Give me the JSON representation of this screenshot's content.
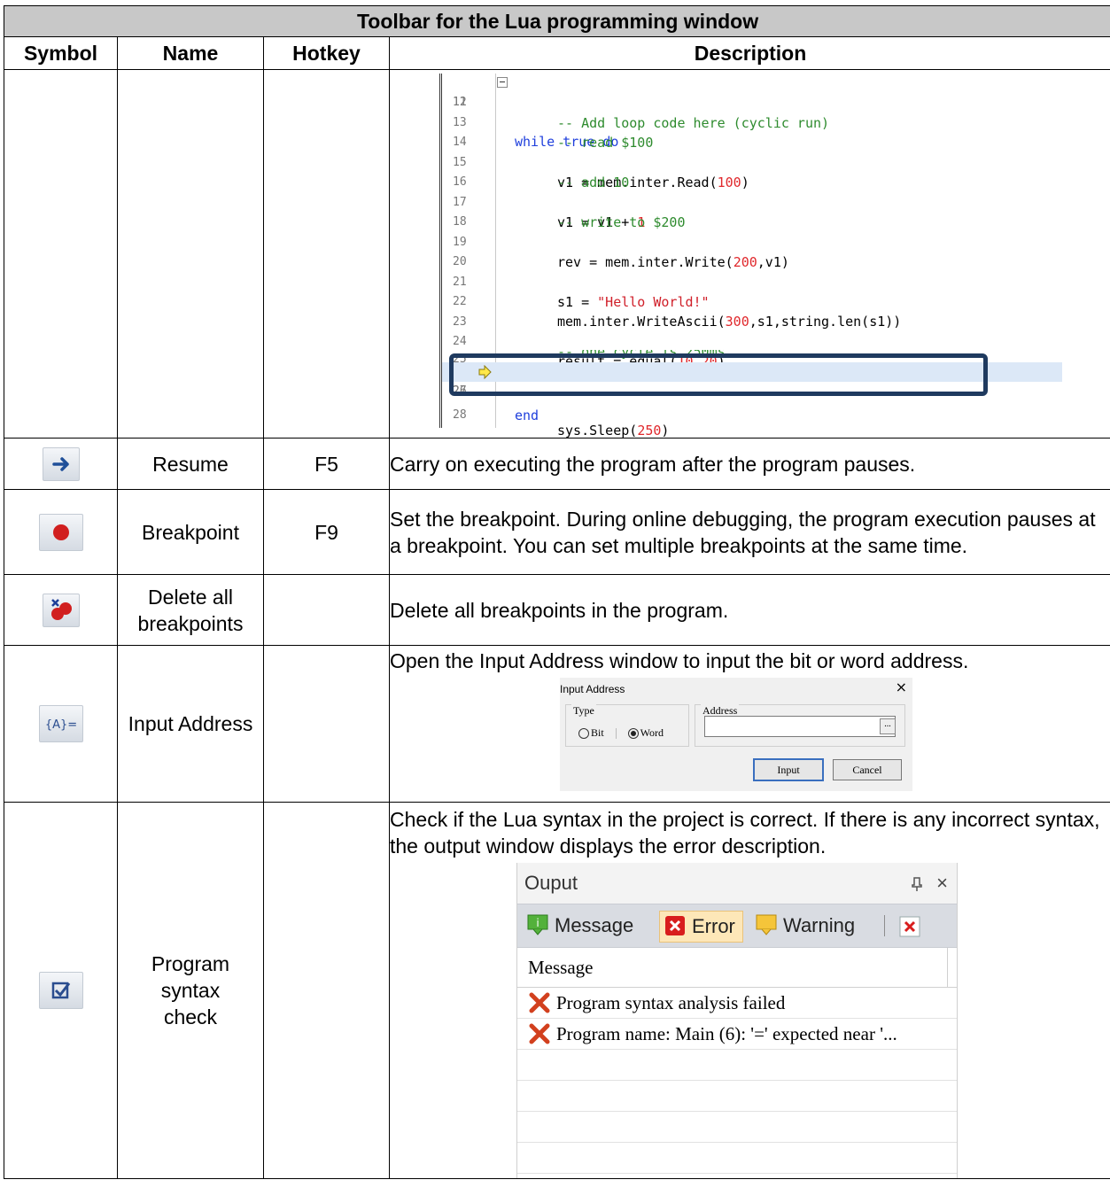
{
  "table": {
    "title": "Toolbar for the Lua programming window",
    "headers": {
      "symbol": "Symbol",
      "name": "Name",
      "hotkey": "Hotkey",
      "description": "Description"
    }
  },
  "code": {
    "lines": [
      {
        "num": "11",
        "text": "while true do"
      },
      {
        "num": "12",
        "text": ""
      },
      {
        "num": "13",
        "text": "-- Add loop code here (cyclic run)"
      },
      {
        "num": "14",
        "text": "-- read $100"
      },
      {
        "num": "15",
        "text": "v1 = mem.inter.Read(100)"
      },
      {
        "num": "16",
        "text": "-- add 10"
      },
      {
        "num": "17",
        "text": "v1 = v1 + 1"
      },
      {
        "num": "18",
        "text": "-- write to $200"
      },
      {
        "num": "19",
        "text": "rev = mem.inter.Write(200,v1)"
      },
      {
        "num": "20",
        "text": ""
      },
      {
        "num": "21",
        "text": "s1 = \"Hello World!\""
      },
      {
        "num": "22",
        "text": "mem.inter.WriteAscii(300,s1,string.len(s1))"
      },
      {
        "num": "23",
        "text": ""
      },
      {
        "num": "24",
        "text": "result = equal(10,20)"
      },
      {
        "num": "25",
        "text": "-- one cycle is 250ms"
      },
      {
        "num": "26",
        "text": "sys.Sleep(250)"
      },
      {
        "num": "27",
        "text": ""
      },
      {
        "num": "28",
        "text": "end"
      }
    ],
    "highlight_color": "#dce8f7",
    "frame_color": "#1f3a5f"
  },
  "rows": [
    {
      "icon": "resume-arrow-icon",
      "name": "Resume",
      "hotkey": "F5",
      "description": "Carry on executing the program after the program pauses."
    },
    {
      "icon": "breakpoint-icon",
      "name": "Breakpoint",
      "hotkey": "F9",
      "description": "Set the breakpoint. During online debugging, the program execution pauses at a breakpoint. You can set multiple breakpoints at the same time."
    },
    {
      "icon": "delete-breakpoints-icon",
      "name": "Delete all breakpoints",
      "hotkey": "",
      "description": "Delete all breakpoints in the program."
    },
    {
      "icon": "input-address-icon",
      "name": "Input Address",
      "hotkey": "",
      "description": "Open the Input Address window to input the bit or word address."
    },
    {
      "icon": "syntax-check-icon",
      "name": "Program syntax check",
      "hotkey": "",
      "description": "Check if the Lua syntax in the project is correct. If there is any incorrect syntax, the output window displays the error description."
    }
  ],
  "input_dialog": {
    "title": "Input Address",
    "close": "×",
    "type_label": "Type",
    "bit_label": "Bit",
    "word_label": "Word",
    "selected": "Word",
    "address_label": "Address",
    "address_value": "",
    "browse": "...",
    "input_button": "Input",
    "cancel_button": "Cancel"
  },
  "output_window": {
    "title": "Ouput",
    "pin": "ᵖ",
    "close": "×",
    "tabs": [
      "Message",
      "Error",
      "Warning"
    ],
    "selected_tab": "Error",
    "column": "Message",
    "messages": [
      "Program syntax analysis failed",
      "Program name: Main (6):  '=' expected near '..."
    ]
  }
}
